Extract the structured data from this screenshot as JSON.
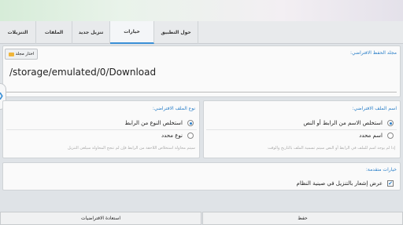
{
  "tabs": [
    {
      "label": "حول التطبيق",
      "active": false
    },
    {
      "label": "خيارات",
      "active": true
    },
    {
      "label": "تنزيل جديد",
      "active": false
    },
    {
      "label": "الملفات",
      "active": false
    },
    {
      "label": "التنزيلات",
      "active": false
    }
  ],
  "folder": {
    "title": "مجلد الحفظ الافتراضي:",
    "choose_button": "اختار مجلد",
    "path": "/storage/emulated/0/Download"
  },
  "file_name": {
    "title": "اسم الملف الافتراضي:",
    "option_extract": "استخلص الاسم من الرابط أو النص",
    "option_custom": "اسم محدد",
    "selected": "extract",
    "hint": "إذا لم يوجد اسم للملف في الرابط أو النص سيتم تسمية الملف بالتاريخ والوقت"
  },
  "file_type": {
    "title": "نوع الملف الافتراضي:",
    "option_extract": "استخلص النوع من الرابط",
    "option_custom": "نوع محدد",
    "selected": "extract",
    "hint": "سيتم محاولة استخلاص اللاحقة من الرابط فإن لم تنجح المحاولة سيلغى التنزيل"
  },
  "advanced": {
    "title": "خيارات متقدمة:",
    "notify_label": "عرض إشعار بالتنزيل في صينية النظام",
    "notify_checked": true
  },
  "footer": {
    "save_label": "حفظ",
    "restore_label": "استعادة الافتراضيات"
  },
  "colors": {
    "accent": "#2a7fc8"
  },
  "icons": {
    "folder": "folder-icon",
    "side_handle": "chevron-right-icon",
    "checkbox": "check-icon"
  }
}
